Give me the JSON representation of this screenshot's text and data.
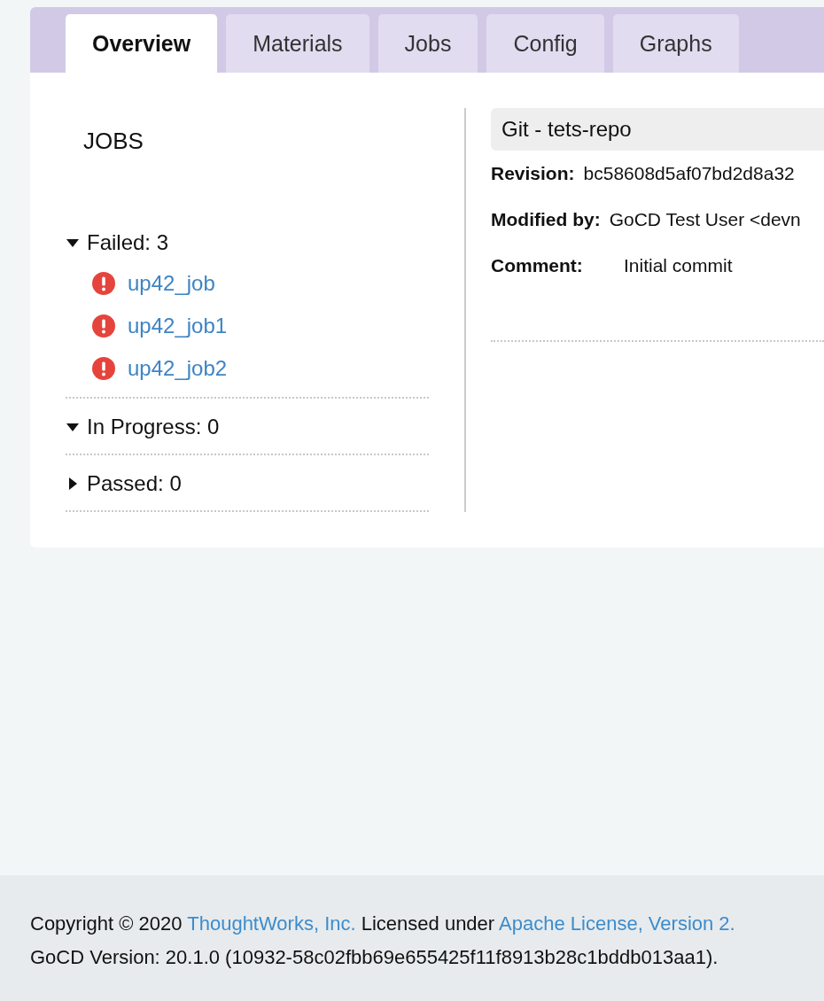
{
  "tabs": [
    {
      "label": "Overview",
      "selected": true
    },
    {
      "label": "Materials",
      "selected": false
    },
    {
      "label": "Jobs",
      "selected": false
    },
    {
      "label": "Config",
      "selected": false
    },
    {
      "label": "Graphs",
      "selected": false
    }
  ],
  "jobs": {
    "title": "JOBS",
    "groups": [
      {
        "label": "Failed: 3",
        "expanded": true,
        "jobs": [
          {
            "name": "up42_job",
            "kind": "failed"
          },
          {
            "name": "up42_job1",
            "kind": "failed"
          },
          {
            "name": "up42_job2",
            "kind": "failed"
          }
        ]
      },
      {
        "label": "In Progress: 0",
        "expanded": true
      },
      {
        "label": "Passed: 0",
        "expanded": false
      }
    ]
  },
  "material": {
    "title": "Git - tets-repo",
    "fields": [
      {
        "label": "Revision:",
        "value": "bc58608d5af07bd2d8a32"
      },
      {
        "label": "Modified by:",
        "value": "GoCD Test User <devn"
      },
      {
        "label": "Comment:",
        "value": "Initial commit"
      }
    ]
  },
  "footer": {
    "copyright": "Copyright © 2020",
    "company_link": "ThoughtWorks, Inc.",
    "licensed": "Licensed under",
    "license_link": "Apache License, Version 2.",
    "version": "GoCD Version: 20.1.0 (10932-58c02fbb69e655425f11f8913b28c1bddb013aa1)."
  }
}
